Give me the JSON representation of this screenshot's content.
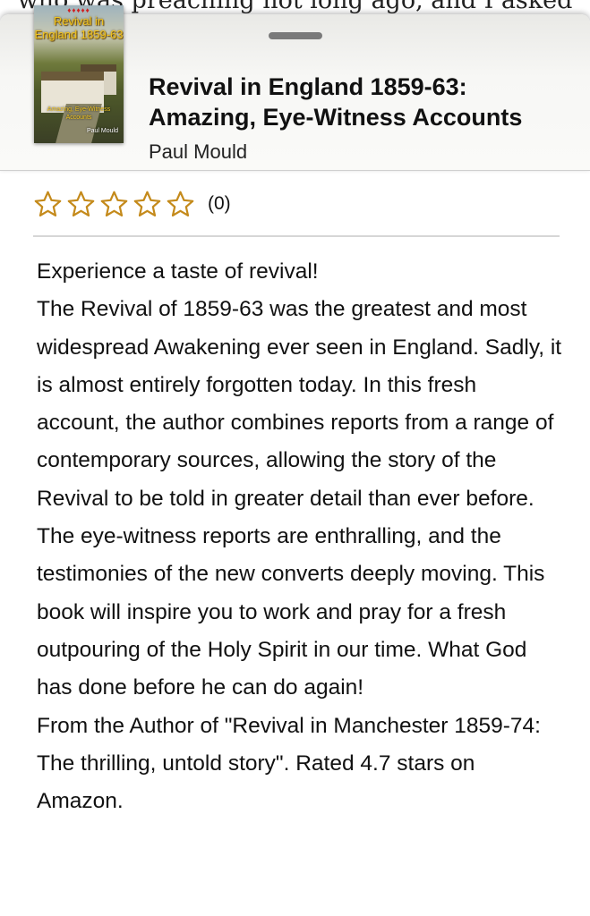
{
  "behind_text": "who was preaching not long ago, and I asked",
  "cover": {
    "title": "Revival in England 1859-63",
    "subtitle": "Amazing, Eye-Witness Accounts",
    "author": "Paul Mould",
    "flames": "♦♦♦♦♦"
  },
  "book": {
    "title": "Revival in England 1859-63: Amazing, Eye-Witness Accounts",
    "author": "Paul Mould"
  },
  "rating": {
    "stars_filled": 0,
    "stars_total": 5,
    "count_label": "(0)",
    "star_color": "#c48a1b"
  },
  "description": {
    "lines": [
      "Experience a taste of revival!",
      "The Revival of 1859-63 was the greatest and most widespread Awakening ever seen in England. Sadly, it is almost entirely forgotten today. In this fresh account, the author combines reports from a range of contemporary sources, allowing the story of the Revival to be told in greater detail than ever before. The eye-witness reports are enthralling, and the testimonies of the new converts deeply moving. This book will inspire you to work and pray for a fresh outpouring of the Holy Spirit in our time. What God has done before he can do again!",
      "From the Author of \"Revival in Manchester 1859-74: The thrilling, untold story\". Rated 4.7 stars on Amazon."
    ]
  }
}
